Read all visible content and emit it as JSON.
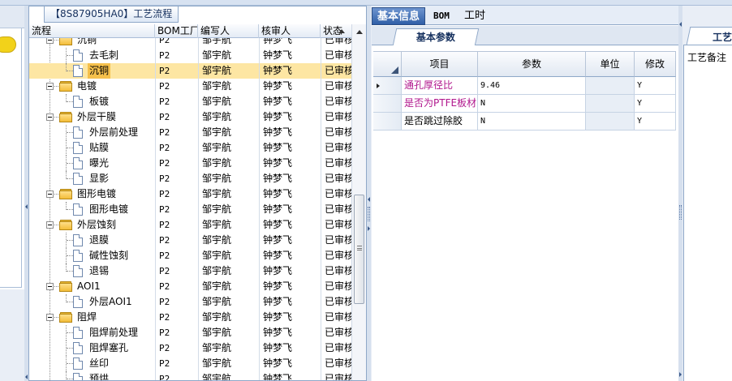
{
  "tree_panel": {
    "title": "【8S87905HA0】工艺流程",
    "columns": [
      "流程",
      "BOM工厂",
      "编写人",
      "核审人",
      "状态"
    ],
    "rows": [
      {
        "name": "沉铜",
        "type": "folder",
        "bom": "P2",
        "writer": "邹宇航",
        "reviewer": "钟梦飞",
        "status": "已审核"
      },
      {
        "name": "去毛刺",
        "type": "doc",
        "bom": "P2",
        "writer": "邹宇航",
        "reviewer": "钟梦飞",
        "status": "已审核"
      },
      {
        "name": "沉铜",
        "type": "doc",
        "bom": "P2",
        "writer": "邹宇航",
        "reviewer": "钟梦飞",
        "status": "已审核",
        "selected": true
      },
      {
        "name": "电镀",
        "type": "folder",
        "bom": "P2",
        "writer": "邹宇航",
        "reviewer": "钟梦飞",
        "status": "已审核"
      },
      {
        "name": "板镀",
        "type": "doc",
        "bom": "P2",
        "writer": "邹宇航",
        "reviewer": "钟梦飞",
        "status": "已审核"
      },
      {
        "name": "外层干膜",
        "type": "folder",
        "bom": "P2",
        "writer": "邹宇航",
        "reviewer": "钟梦飞",
        "status": "已审核"
      },
      {
        "name": "外层前处理",
        "type": "doc",
        "bom": "P2",
        "writer": "邹宇航",
        "reviewer": "钟梦飞",
        "status": "已审核"
      },
      {
        "name": "贴膜",
        "type": "doc",
        "bom": "P2",
        "writer": "邹宇航",
        "reviewer": "钟梦飞",
        "status": "已审核"
      },
      {
        "name": "曝光",
        "type": "doc",
        "bom": "P2",
        "writer": "邹宇航",
        "reviewer": "钟梦飞",
        "status": "已审核"
      },
      {
        "name": "显影",
        "type": "doc",
        "bom": "P2",
        "writer": "邹宇航",
        "reviewer": "钟梦飞",
        "status": "已审核"
      },
      {
        "name": "图形电镀",
        "type": "folder",
        "bom": "P2",
        "writer": "邹宇航",
        "reviewer": "钟梦飞",
        "status": "已审核"
      },
      {
        "name": "图形电镀",
        "type": "doc",
        "bom": "P2",
        "writer": "邹宇航",
        "reviewer": "钟梦飞",
        "status": "已审核"
      },
      {
        "name": "外层蚀刻",
        "type": "folder",
        "bom": "P2",
        "writer": "邹宇航",
        "reviewer": "钟梦飞",
        "status": "已审核"
      },
      {
        "name": "退膜",
        "type": "doc",
        "bom": "P2",
        "writer": "邹宇航",
        "reviewer": "钟梦飞",
        "status": "已审核"
      },
      {
        "name": "碱性蚀刻",
        "type": "doc",
        "bom": "P2",
        "writer": "邹宇航",
        "reviewer": "钟梦飞",
        "status": "已审核"
      },
      {
        "name": "退锡",
        "type": "doc",
        "bom": "P2",
        "writer": "邹宇航",
        "reviewer": "钟梦飞",
        "status": "已审核"
      },
      {
        "name": "AOI1",
        "type": "folder",
        "bom": "P2",
        "writer": "邹宇航",
        "reviewer": "钟梦飞",
        "status": "已审核"
      },
      {
        "name": "外层AOI1",
        "type": "doc",
        "bom": "P2",
        "writer": "邹宇航",
        "reviewer": "钟梦飞",
        "status": "已审核"
      },
      {
        "name": "阻焊",
        "type": "folder",
        "bom": "P2",
        "writer": "邹宇航",
        "reviewer": "钟梦飞",
        "status": "已审核"
      },
      {
        "name": "阻焊前处理",
        "type": "doc",
        "bom": "P2",
        "writer": "邹宇航",
        "reviewer": "钟梦飞",
        "status": "已审核"
      },
      {
        "name": "阻焊塞孔",
        "type": "doc",
        "bom": "P2",
        "writer": "邹宇航",
        "reviewer": "钟梦飞",
        "status": "已审核"
      },
      {
        "name": "丝印",
        "type": "doc",
        "bom": "P2",
        "writer": "邹宇航",
        "reviewer": "钟梦飞",
        "status": "已审核"
      },
      {
        "name": "预烘",
        "type": "doc",
        "bom": "P2",
        "writer": "邹宇航",
        "reviewer": "钟梦飞",
        "status": "已审核"
      }
    ]
  },
  "main_tabs": [
    "基本信息",
    "BOM",
    "工时"
  ],
  "sub_tab": "基本参数",
  "param_grid": {
    "headers": [
      "项目",
      "参数",
      "单位",
      "修改"
    ],
    "rows": [
      {
        "item": "通孔厚径比",
        "value": "9.46",
        "unit": "",
        "modified": "Y",
        "highlight": true,
        "current": true
      },
      {
        "item": "是否为PTFE板材",
        "value": "N",
        "unit": "",
        "modified": "Y",
        "highlight": true,
        "current": false
      },
      {
        "item": "是否跳过除胶",
        "value": "N",
        "unit": "",
        "modified": "Y",
        "highlight": false,
        "current": false
      }
    ]
  },
  "right_panel": {
    "tab": "工艺",
    "note_label": "工艺备注"
  },
  "colors": {
    "selected_row": "#fde6a3",
    "active_tab": "#2f5fa7",
    "highlight_text": "#b0158c"
  }
}
